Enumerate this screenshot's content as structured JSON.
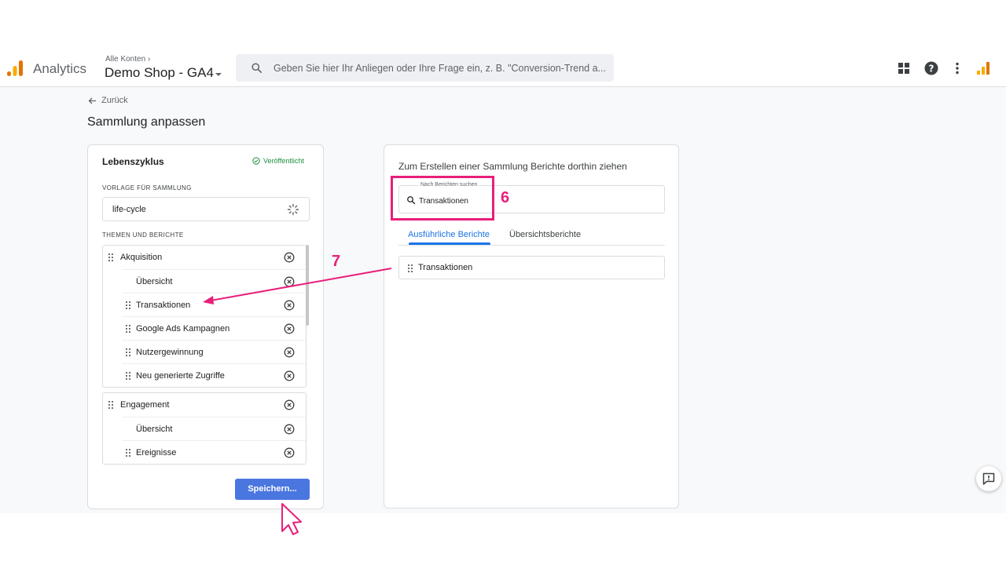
{
  "header": {
    "app_name": "Analytics",
    "account_crumb": "Alle Konten",
    "property_name": "Demo Shop - GA4",
    "search_placeholder": "Geben Sie hier Ihr Anliegen oder Ihre Frage ein, z. B. \"Conversion-Trend a...",
    "icons": [
      "apps-grid-icon",
      "help-icon",
      "more-vert-icon",
      "analytics-logo-icon"
    ]
  },
  "page": {
    "back_label": "Zurück",
    "title": "Sammlung anpassen"
  },
  "left_panel": {
    "title": "Lebenszyklus",
    "status": "Veröffentlicht",
    "template_label": "VORLAGE FÜR SAMMLUNG",
    "template_value": "life-cycle",
    "topics_label": "THEMEN UND BERICHTE",
    "groups": [
      {
        "label": "Akquisition",
        "items": [
          "Übersicht",
          "Transaktionen",
          "Google Ads Kampagnen",
          "Nutzergewinnung",
          "Neu generierte Zugriffe"
        ]
      },
      {
        "label": "Engagement",
        "items": [
          "Übersicht",
          "Ereignisse"
        ]
      }
    ],
    "save_label": "Speichern..."
  },
  "right_panel": {
    "title": "Zum Erstellen einer Sammlung Berichte dorthin ziehen",
    "search_label": "Nach Berichten suchen",
    "search_value": "Transaktionen",
    "tabs": [
      "Ausführliche Berichte",
      "Übersichtsberichte"
    ],
    "active_tab": "Ausführliche Berichte",
    "results": [
      "Transaktionen"
    ]
  },
  "annotations": {
    "step_6": "6",
    "step_7": "7",
    "accent_color": "#e91e7a"
  },
  "colors": {
    "primary_blue": "#4a76df",
    "link_blue": "#1a73e8",
    "published_green": "#1e8e3e"
  }
}
